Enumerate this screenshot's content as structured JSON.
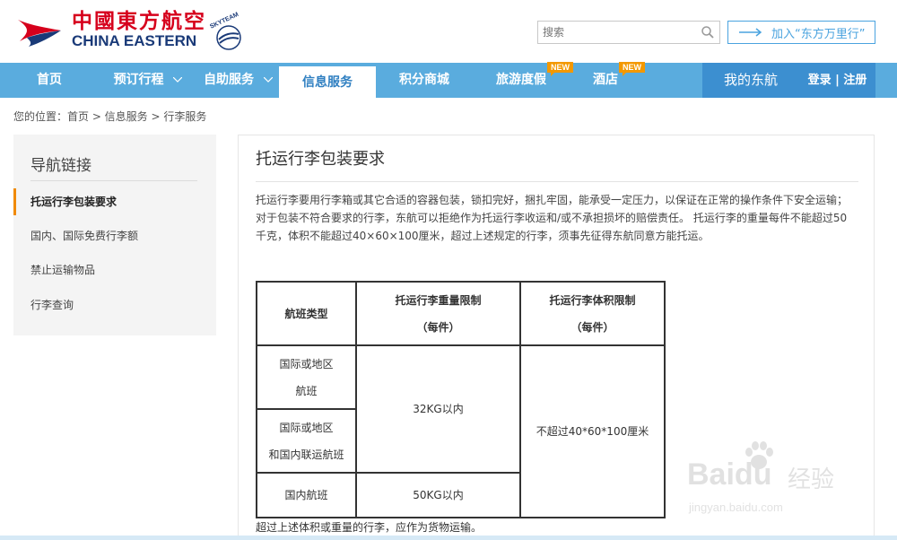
{
  "header": {
    "logo_cn": "中國東方航空",
    "logo_en": "CHINA EASTERN",
    "skyteam_text": "SKYTEAM",
    "search_placeholder": "搜索",
    "join_label": "加入“东方万里行”"
  },
  "nav": {
    "items": [
      {
        "label": "首页"
      },
      {
        "label": "预订行程"
      },
      {
        "label": "自助服务"
      },
      {
        "label": "信息服务"
      },
      {
        "label": "积分商城"
      },
      {
        "label": "旅游度假",
        "badge": "NEW"
      },
      {
        "label": "酒店",
        "badge": "NEW"
      }
    ],
    "my_account": "我的东航",
    "login": "登录",
    "separator": "|",
    "register": "注册"
  },
  "breadcrumb": "您的位置：首页 > 信息服务 > 行李服务",
  "sidebar": {
    "title": "导航链接",
    "items": [
      {
        "label": "托运行李包装要求"
      },
      {
        "label": "国内、国际免费行李额"
      },
      {
        "label": "禁止运输物品"
      },
      {
        "label": "行李查询"
      }
    ]
  },
  "main": {
    "title": "托运行李包装要求",
    "paragraph": "托运行李要用行李箱或其它合适的容器包装，锁扣完好，捆扎牢固，能承受一定压力，以保证在正常的操作条件下安全运输；对于包装不符合要求的行李，东航可以拒绝作为托运行李收运和/或不承担损坏的赔偿责任。 托运行李的重量每件不能超过50 千克，体积不能超过40×60×100厘米，超过上述规定的行李，须事先征得东航同意方能托运。",
    "table": {
      "h_type": "航班类型",
      "h_weight": "托运行李重量限制",
      "h_weight_sub": "（每件）",
      "h_volume": "托运行李体积限制",
      "h_volume_sub": "（每件）",
      "r1_type_a": "国际或地区",
      "r1_type_b": "航班",
      "r2_type_a": "国际或地区",
      "r2_type_b": "和国内联运航班",
      "intl_weight": "32KG以内",
      "volume": "不超过40*60*100厘米",
      "dom_type": "国内航班",
      "dom_weight": "50KG以内"
    },
    "note": "超过上述体积或重量的行李，应作为货物运输。"
  },
  "watermark": {
    "brand": "Bai",
    "brand2": "du",
    "cn": "经验",
    "url": "jingyan.baidu.com"
  },
  "colors": {
    "brand_red": "#d6001c",
    "brand_navy": "#1a3a78",
    "nav_blue": "#5aacde",
    "accent_orange": "#f08a00"
  }
}
